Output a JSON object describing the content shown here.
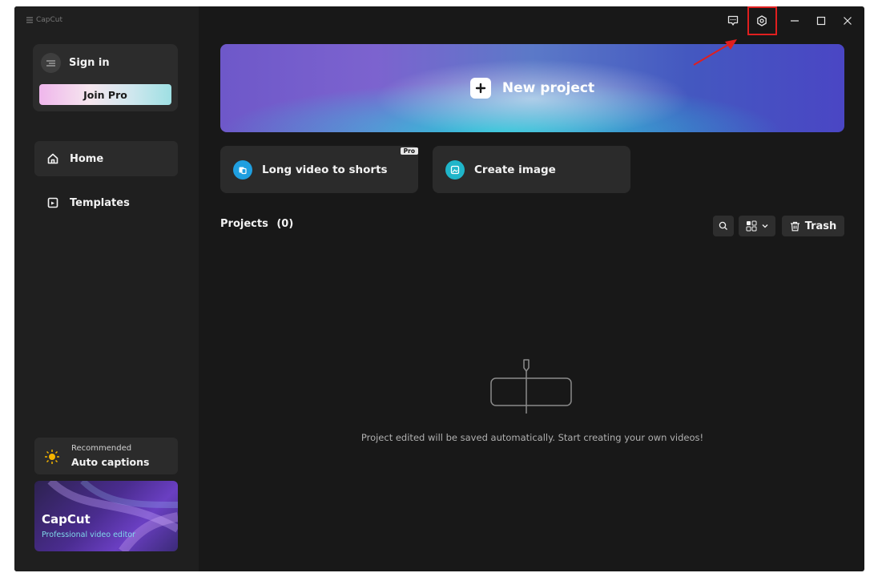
{
  "app": {
    "title": "CapCut"
  },
  "account": {
    "sign_in": "Sign in",
    "join_pro": "Join Pro"
  },
  "nav": [
    {
      "label": "Home",
      "icon": "home-icon",
      "active": true
    },
    {
      "label": "Templates",
      "icon": "templates-icon",
      "active": false
    }
  ],
  "recommended": {
    "caption": "Recommended",
    "title": "Auto captions",
    "icon": "sun-icon"
  },
  "promo": {
    "title": "CapCut",
    "subtitle": "Professional video editor"
  },
  "titlebar": {
    "icons": [
      "feedback-icon",
      "settings-icon",
      "minimize-icon",
      "maximize-icon",
      "close-icon"
    ],
    "highlighted": "settings-icon",
    "highlight_color": "#e01f1f"
  },
  "main": {
    "new_project": "New project",
    "tools": [
      {
        "label": "Long video to shorts",
        "badge": "Pro",
        "icon": "shorts-icon"
      },
      {
        "label": "Create image",
        "icon": "image-icon"
      }
    ],
    "projects_label": "Projects",
    "projects_count": "(0)",
    "trash_label": "Trash",
    "empty_message": "Project edited will be saved automatically. Start creating your own videos!"
  },
  "colors": {
    "background": "#181818",
    "sidebar": "#1f1f1f",
    "card": "#2b2b2b",
    "accent_blue": "#1f9fe0"
  }
}
